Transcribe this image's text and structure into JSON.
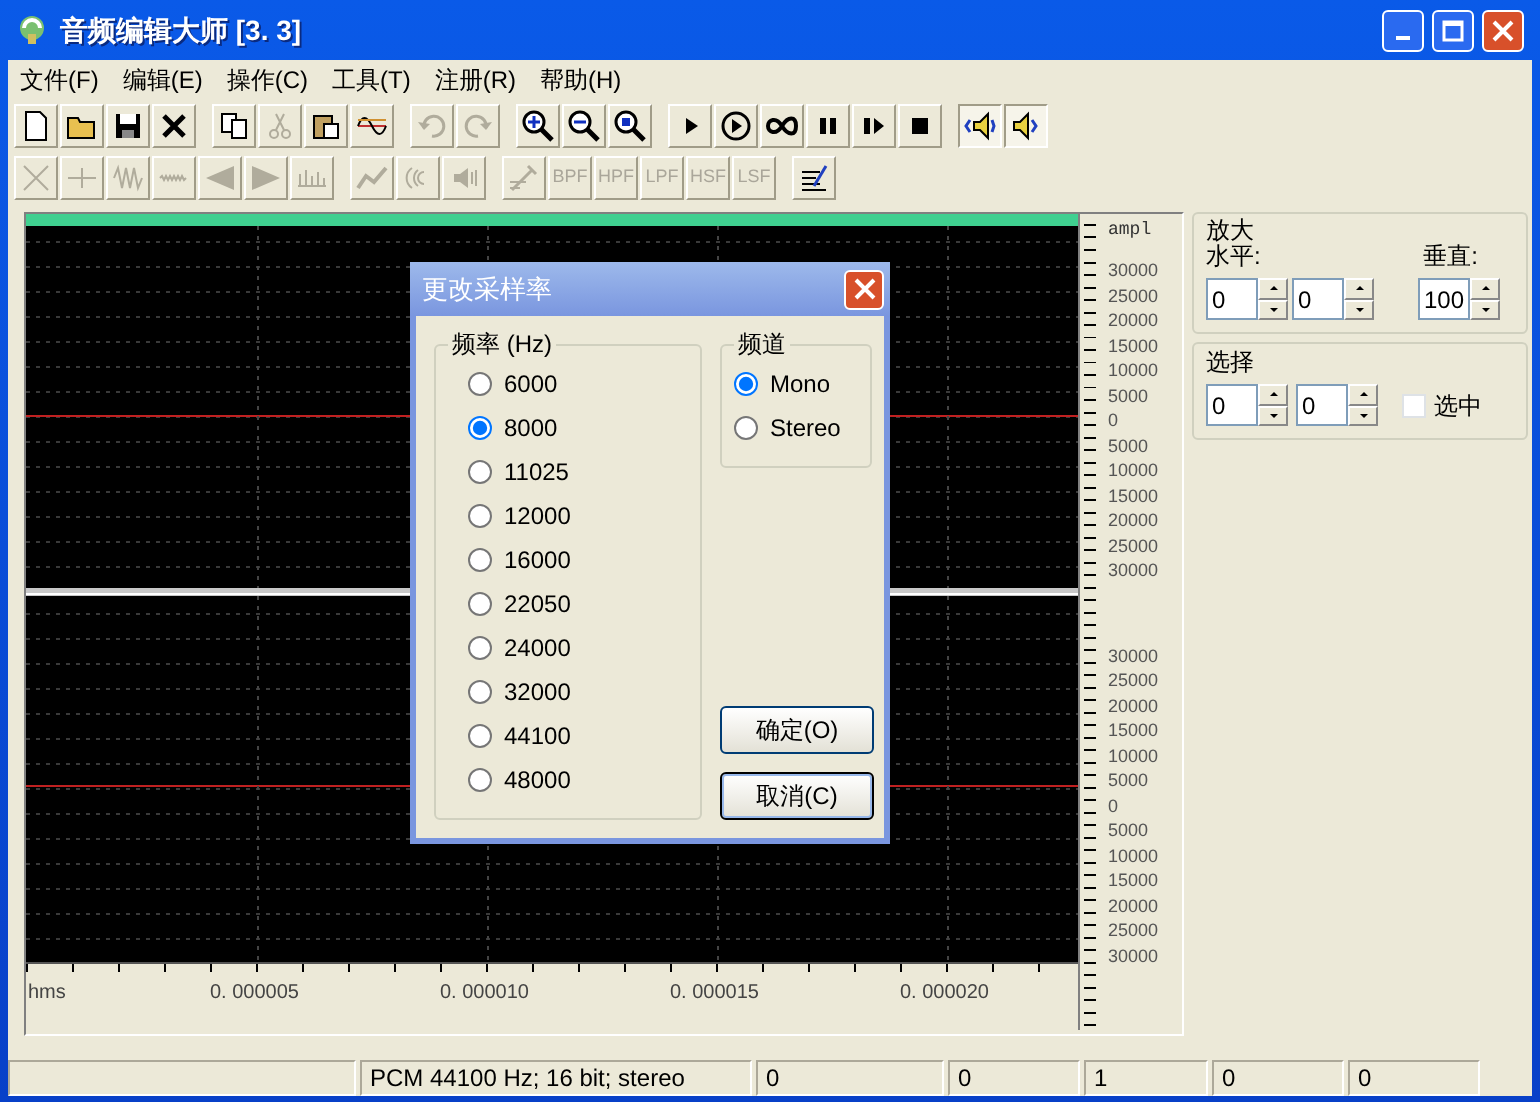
{
  "window": {
    "title": "音频编辑大师 [3. 3]"
  },
  "menu": [
    "文件(F)",
    "编辑(E)",
    "操作(C)",
    "工具(T)",
    "注册(R)",
    "帮助(H)"
  ],
  "toolbar_1": [
    [
      {
        "kind": "icon",
        "disabled": false
      },
      {
        "kind": "icon",
        "disabled": false
      },
      {
        "kind": "icon",
        "disabled": false
      },
      {
        "kind": "icon",
        "disabled": false
      }
    ],
    [
      {
        "kind": "icon",
        "disabled": false
      },
      {
        "kind": "icon",
        "disabled": true
      },
      {
        "kind": "icon",
        "disabled": false
      },
      {
        "kind": "icon",
        "disabled": false
      }
    ],
    [
      {
        "kind": "icon",
        "disabled": true
      },
      {
        "kind": "icon",
        "disabled": true
      }
    ],
    [
      {
        "kind": "icon",
        "disabled": false
      },
      {
        "kind": "icon",
        "disabled": false
      },
      {
        "kind": "icon",
        "disabled": false
      }
    ],
    [
      {
        "kind": "icon",
        "disabled": false
      },
      {
        "kind": "icon",
        "disabled": false
      },
      {
        "kind": "icon",
        "disabled": false
      },
      {
        "kind": "icon",
        "disabled": false
      },
      {
        "kind": "icon",
        "disabled": false
      },
      {
        "kind": "icon",
        "disabled": false
      }
    ],
    [
      {
        "kind": "icon",
        "disabled": false,
        "pressed": true
      },
      {
        "kind": "icon",
        "disabled": false,
        "pressed": true
      }
    ]
  ],
  "toolbar_2": [
    [
      {
        "kind": "icon",
        "disabled": true
      },
      {
        "kind": "icon",
        "disabled": true
      },
      {
        "kind": "icon",
        "disabled": true
      },
      {
        "kind": "icon",
        "disabled": true
      },
      {
        "kind": "icon",
        "disabled": true
      },
      {
        "kind": "icon",
        "disabled": true
      },
      {
        "kind": "icon",
        "disabled": true
      }
    ],
    [
      {
        "kind": "icon",
        "disabled": true
      },
      {
        "kind": "icon",
        "disabled": true
      },
      {
        "kind": "icon",
        "disabled": true
      }
    ],
    [
      {
        "kind": "icon",
        "disabled": true
      },
      {
        "kind": "text",
        "label": "BPF",
        "disabled": true
      },
      {
        "kind": "text",
        "label": "HPF",
        "disabled": true
      },
      {
        "kind": "text",
        "label": "LPF",
        "disabled": true
      },
      {
        "kind": "text",
        "label": "HSF",
        "disabled": true
      },
      {
        "kind": "text",
        "label": "LSF",
        "disabled": true
      }
    ],
    [
      {
        "kind": "icon",
        "disabled": false
      }
    ]
  ],
  "amplitude_ruler": {
    "header": "ampl",
    "channels": [
      [
        "30000",
        "25000",
        "20000",
        "15000",
        "10000",
        "5000",
        "0",
        "5000",
        "10000",
        "15000",
        "20000",
        "25000",
        "30000"
      ],
      [
        "30000",
        "25000",
        "20000",
        "15000",
        "10000",
        "5000",
        "0",
        "5000",
        "10000",
        "15000",
        "20000",
        "25000",
        "30000"
      ]
    ]
  },
  "time_ruler": {
    "unit": "hms",
    "labels": [
      "0. 000005",
      "0. 000010",
      "0. 000015",
      "0. 000020"
    ]
  },
  "zoom_group": {
    "title": "放大",
    "horizontal_label": "水平:",
    "vertical_label": "垂直:",
    "horizontal_values": [
      "0",
      "0"
    ],
    "vertical_value": "100"
  },
  "select_group": {
    "title": "选择",
    "values": [
      "0",
      "0"
    ],
    "checkbox": {
      "label": "选中",
      "checked": false
    }
  },
  "dialog": {
    "title": "更改采样率",
    "frequency_group": {
      "title": "频率 (Hz)",
      "options": [
        {
          "label": "6000",
          "selected": false
        },
        {
          "label": "8000",
          "selected": true
        },
        {
          "label": "11025",
          "selected": false
        },
        {
          "label": "12000",
          "selected": false
        },
        {
          "label": "16000",
          "selected": false
        },
        {
          "label": "22050",
          "selected": false
        },
        {
          "label": "24000",
          "selected": false
        },
        {
          "label": "32000",
          "selected": false
        },
        {
          "label": "44100",
          "selected": false
        },
        {
          "label": "48000",
          "selected": false
        }
      ]
    },
    "channel_group": {
      "title": "频道",
      "options": [
        {
          "label": "Mono",
          "selected": true
        },
        {
          "label": "Stereo",
          "selected": false
        }
      ]
    },
    "buttons": [
      {
        "label": "确定(O)",
        "default": false
      },
      {
        "label": "取消(C)",
        "default": true
      }
    ]
  },
  "status_bar": [
    "PCM 44100 Hz; 16 bit; stereo",
    "0",
    "0",
    "1",
    "0",
    "0"
  ]
}
